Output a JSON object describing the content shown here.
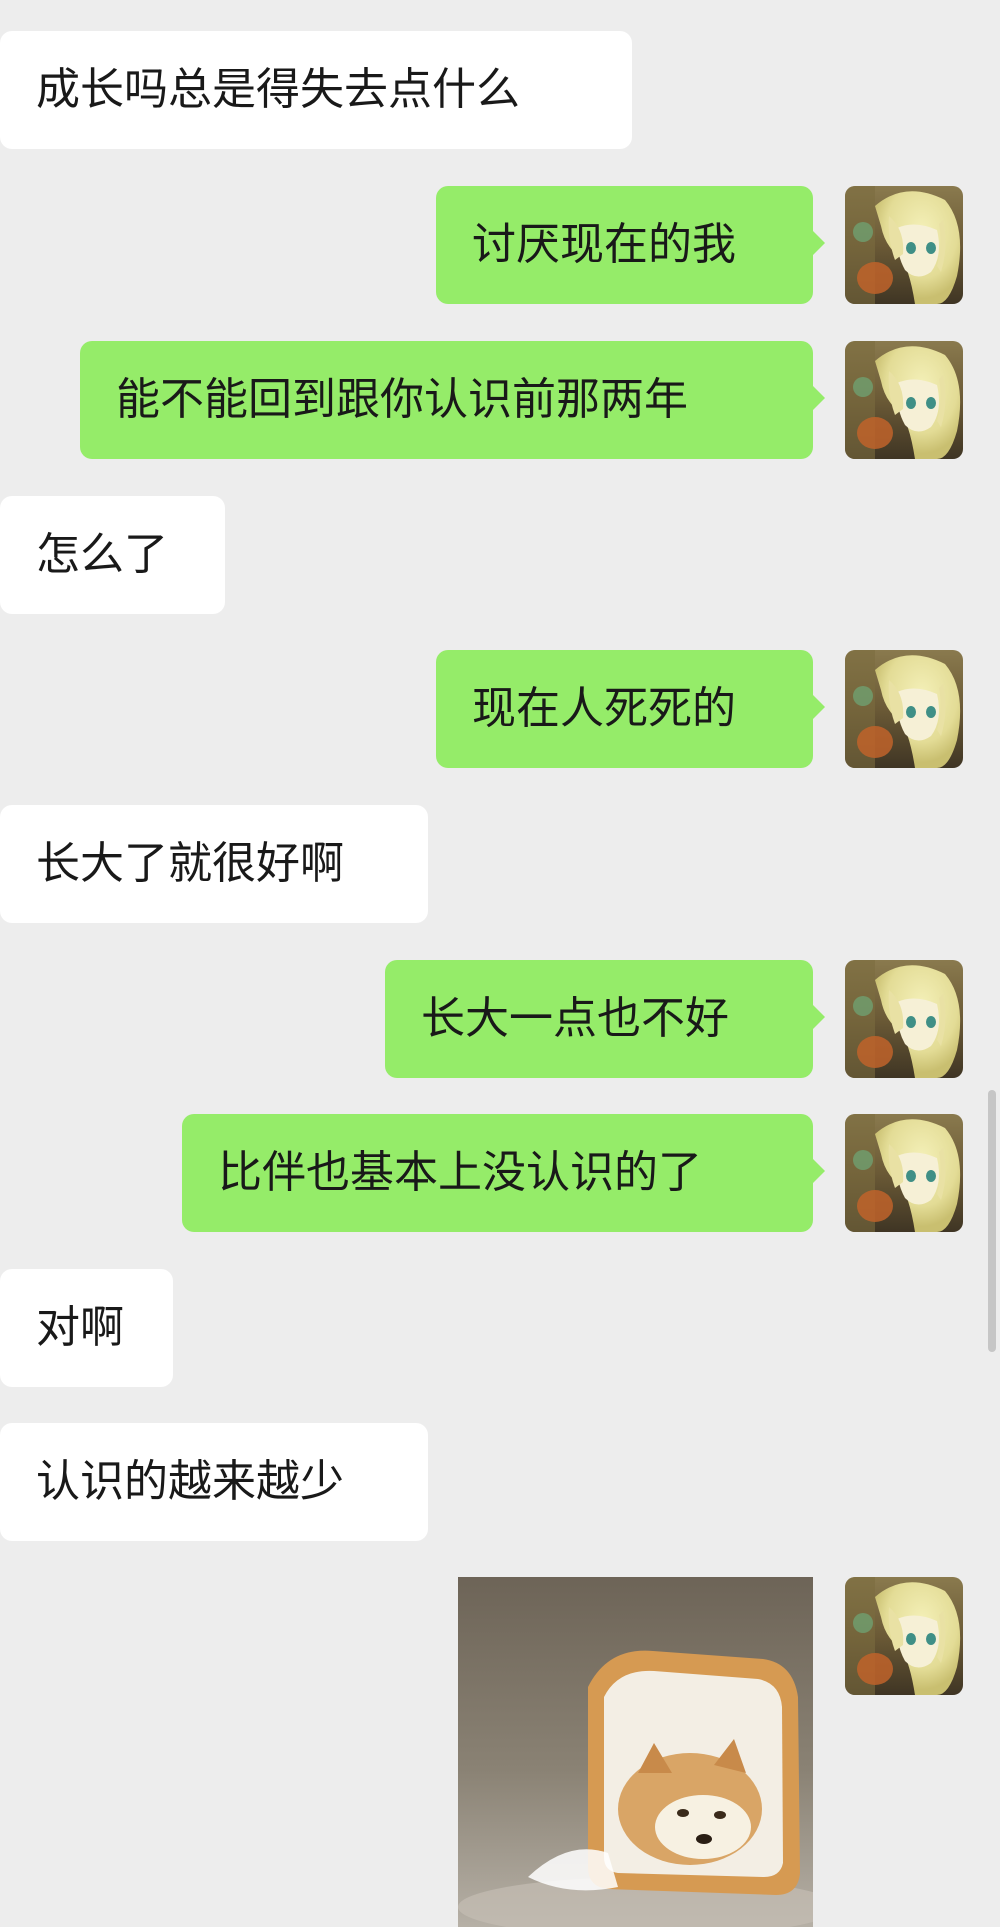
{
  "messages": [
    {
      "side": "in",
      "text": "成长吗总是得失去点什么"
    },
    {
      "side": "out",
      "text": "讨厌现在的我"
    },
    {
      "side": "out",
      "text": "能不能回到跟你认识前那两年"
    },
    {
      "side": "in",
      "text": "怎么了"
    },
    {
      "side": "out",
      "text": "现在人死死的"
    },
    {
      "side": "in",
      "text": "长大了就很好啊"
    },
    {
      "side": "out",
      "text": "长大一点也不好"
    },
    {
      "side": "out",
      "text": "比伴也基本上没认识的了"
    },
    {
      "side": "in",
      "text": "对啊"
    },
    {
      "side": "in",
      "text": "认识的越来越少"
    },
    {
      "side": "out",
      "type": "sticker",
      "sticker": "cat-in-bread-sticker"
    }
  ],
  "colors": {
    "background": "#ededed",
    "incoming_bubble": "#ffffff",
    "outgoing_bubble": "#95ec69",
    "text": "#191919"
  }
}
